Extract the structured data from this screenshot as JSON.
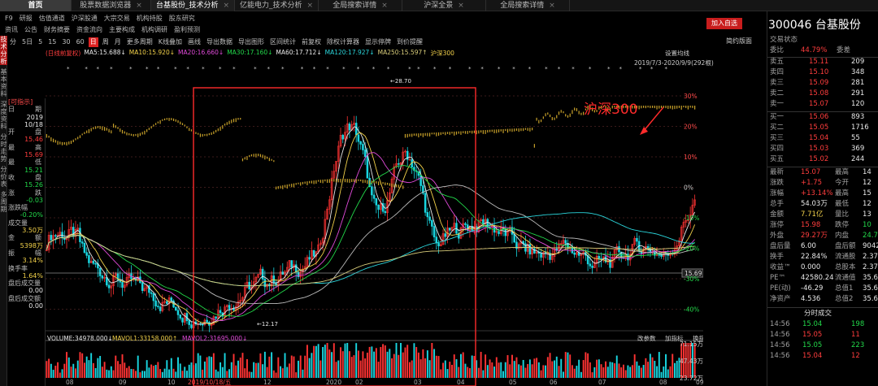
{
  "tabs": [
    {
      "label": "首页"
    },
    {
      "label": "股票数据浏览器"
    },
    {
      "label": "台基股份_技术分析"
    },
    {
      "label": "亿能电力_技术分析"
    },
    {
      "label": "全局搜索详情"
    },
    {
      "label": "沪深全景"
    },
    {
      "label": "全局搜索详情"
    }
  ],
  "menu1": [
    "F9",
    "研报",
    "估值通道",
    "沪深股通",
    "大宗交易",
    "机构持股",
    "股东研究"
  ],
  "menu2": [
    "资讯",
    "公告",
    "财务摘要",
    "资金流向",
    "主要构成",
    "机构调研",
    "盈利预测"
  ],
  "sidebar": [
    "技术分析",
    "基本资料",
    "深度资料",
    "分时走势",
    "分价表",
    "多周期"
  ],
  "toolbar": [
    "分",
    "5日",
    "5",
    "15",
    "30",
    "60",
    "日",
    "周",
    "月",
    "更多周期",
    "K线叠加",
    "画线",
    "导出数据",
    "导出图形",
    "区间统计",
    "前复权",
    "除权计算器",
    "显示停牌",
    "到价提醒"
  ],
  "toolbar_selected": "日",
  "simple_btn": "简约版面",
  "add_btn": "加入自选",
  "stock": {
    "code": "300046",
    "name": "台基股份"
  },
  "ma": {
    "prefix": "(日线前复权)",
    "ma5": "MA5:15.688↓",
    "ma10": "MA10:15.920↓",
    "ma20": "MA20:16.660↓",
    "ma30": "MA30:17.160↓",
    "ma60": "MA60:17.712↓",
    "ma120": "MA120:17.927↓",
    "ma250": "MA250:15.597↑",
    "overlay": "沪深300",
    "setting": "设置均线"
  },
  "range_label": "2019/7/3-2020/9/9(292根)",
  "annotation": "沪深300",
  "price_labels": {
    "high": "28.70",
    "low": "12.17",
    "cur": "15.69"
  },
  "percent_ticks": [
    "30%",
    "20%",
    "10%",
    "0%",
    "-10%",
    "-20%",
    "-30%",
    "-40%"
  ],
  "volume_ticks": [
    "71.15万",
    "47.43万",
    "23.72万"
  ],
  "vol_line": {
    "volume": "VOLUME:34978.000↓",
    "mavol1": "MAVOL1:33158.000↑",
    "mavol2": "MAVOL2:31695.000↓"
  },
  "vol_tools": [
    "改参数",
    "加指标",
    "换指标"
  ],
  "x_axis": [
    "08",
    "09",
    "10",
    "2019/10/18/五",
    "12",
    "2020",
    "02",
    "03",
    "04",
    "05",
    "06",
    "07",
    "08",
    "09"
  ],
  "leftinfo": [
    [
      "[可指示]",
      ""
    ],
    [
      "日",
      "期"
    ],
    [
      "",
      "2019"
    ],
    [
      "",
      "10/18"
    ],
    [
      "开",
      "盘"
    ],
    [
      "",
      "15.46"
    ],
    [
      "最",
      "高"
    ],
    [
      "",
      "15.69"
    ],
    [
      "最",
      "低"
    ],
    [
      "",
      "15.21"
    ],
    [
      "收",
      "盘"
    ],
    [
      "",
      "15.26"
    ],
    [
      "涨",
      "跌"
    ],
    [
      "",
      "-0.03"
    ],
    [
      "涨跌幅",
      ""
    ],
    [
      "",
      "-0.20%"
    ],
    [
      "成交量",
      ""
    ],
    [
      "",
      "3.50万"
    ],
    [
      "金",
      "额"
    ],
    [
      "",
      "5398万"
    ],
    [
      "振",
      "幅"
    ],
    [
      "",
      "3.14%"
    ],
    [
      "换手率",
      ""
    ],
    [
      "",
      "1.64%"
    ],
    [
      "盘后成交量",
      ""
    ],
    [
      "",
      "0.00"
    ],
    [
      "盘后成交额",
      ""
    ],
    [
      "",
      "0.00"
    ]
  ],
  "right": {
    "ratio": {
      "l1": "交易状态",
      "l2": "委比",
      "v2": "44.79%",
      "l3": "委差"
    },
    "asks": [
      [
        "卖五",
        "15.11",
        "209"
      ],
      [
        "卖四",
        "15.10",
        "348"
      ],
      [
        "卖三",
        "15.09",
        "281"
      ],
      [
        "卖二",
        "15.08",
        "291"
      ],
      [
        "卖一",
        "15.07",
        "120"
      ]
    ],
    "bids": [
      [
        "买一",
        "15.06",
        "893"
      ],
      [
        "买二",
        "15.05",
        "1716"
      ],
      [
        "买三",
        "15.04",
        "55"
      ],
      [
        "买四",
        "15.03",
        "369"
      ],
      [
        "买五",
        "15.02",
        "244"
      ]
    ],
    "stats": [
      [
        "最新",
        "15.07",
        "最高",
        "14"
      ],
      [
        "涨跌",
        "+1.75",
        "今开",
        "12"
      ],
      [
        "涨幅",
        "+13.14%",
        "最高",
        "15"
      ],
      [
        "总手",
        "54.03万",
        "最低",
        "12"
      ],
      [
        "金额",
        "7.71亿",
        "量比",
        "13"
      ],
      [
        "涨停",
        "15.98",
        "跌停",
        "10"
      ],
      [
        "外盘",
        "29.27万",
        "内盘",
        "24.76"
      ],
      [
        "盘后量",
        "6.00",
        "盘后额",
        "9042"
      ],
      [
        "换手",
        "22.84%",
        "流通股",
        "2.37"
      ],
      [
        "收益™",
        "0.000",
        "总股本",
        "2.37"
      ],
      [
        "PE™",
        "42580.24",
        "流通值",
        "35.65"
      ],
      [
        "PE(动)",
        "-46.29",
        "总值1",
        "35.65"
      ],
      [
        "净资产",
        "4.536",
        "总值2",
        "35.65"
      ]
    ],
    "ticks_title": "分时成交",
    "ticks": [
      [
        "14:56",
        "15.04",
        "198"
      ],
      [
        "14:56",
        "15.05",
        "11"
      ],
      [
        "14:56",
        "15.05",
        "223"
      ],
      [
        "14:56",
        "15.04",
        "12"
      ]
    ]
  }
}
